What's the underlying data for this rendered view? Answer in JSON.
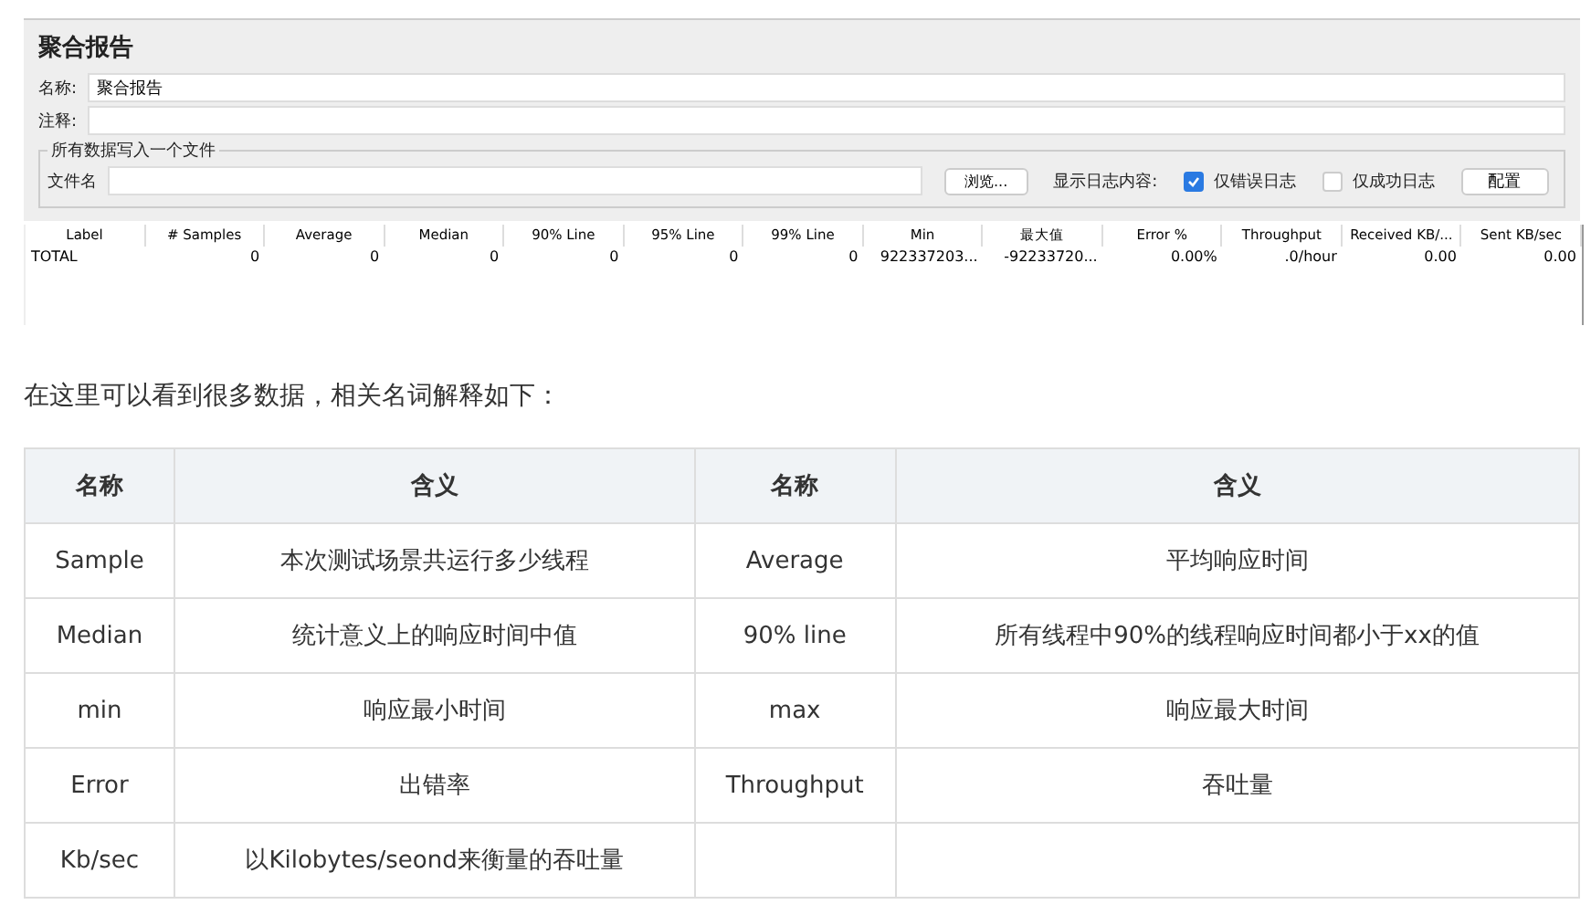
{
  "report": {
    "title": "聚合报告",
    "name_label": "名称:",
    "name_value": "聚合报告",
    "comment_label": "注释:",
    "group_title": "所有数据写入一个文件",
    "file_label": "文件名",
    "browse": "浏览...",
    "log_label": "显示日志内容:",
    "checks": [
      {
        "label": "仅错误日志",
        "checked": true
      },
      {
        "label": "仅成功日志",
        "checked": false
      }
    ],
    "config": "配置",
    "columns": [
      "Label",
      "# Samples",
      "Average",
      "Median",
      "90% Line",
      "95% Line",
      "99% Line",
      "Min",
      "最大值",
      "Error %",
      "Throughput",
      "Received KB/...",
      "Sent KB/sec"
    ],
    "rows": [
      [
        "TOTAL",
        "0",
        "0",
        "0",
        "0",
        "0",
        "0",
        "922337203...",
        "-92233720...",
        "0.00%",
        ".0/hour",
        "0.00",
        "0.00"
      ]
    ]
  },
  "intro": "在这里可以看到很多数据，相关名词解释如下：",
  "glossary": {
    "columns": [
      "名称",
      "含义",
      "名称",
      "含义"
    ],
    "rows": [
      [
        "Sample",
        "本次测试场景共运行多少线程",
        "Average",
        "平均响应时间"
      ],
      [
        "Median",
        "统计意义上的响应时间中值",
        "90% line",
        "所有线程中90%的线程响应时间都小于xx的值"
      ],
      [
        "min",
        "响应最小时间",
        "max",
        "响应最大时间"
      ],
      [
        "Error",
        "出错率",
        "Throughput",
        "吞吐量"
      ],
      [
        "Kb/sec",
        "以Kilobytes/seond来衡量的吞吐量",
        "",
        ""
      ]
    ]
  }
}
